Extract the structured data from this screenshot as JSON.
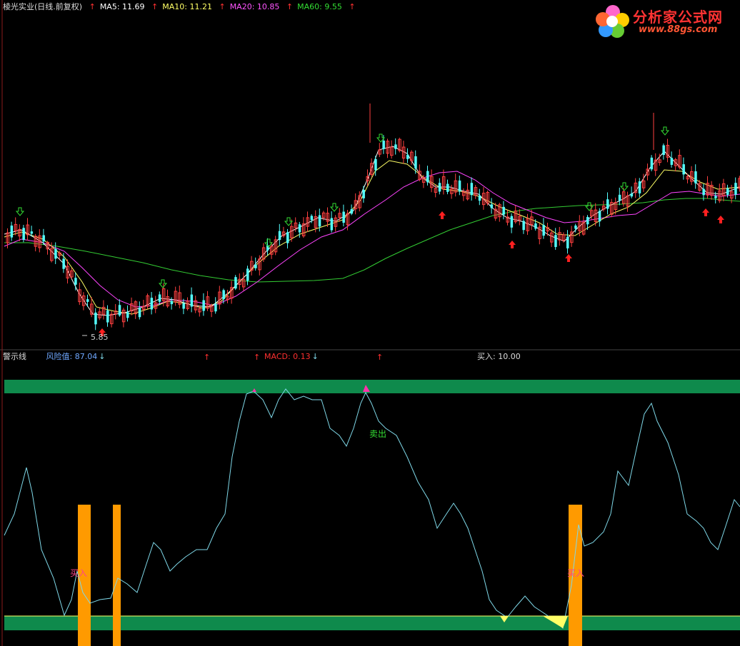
{
  "top": {
    "title": "棱光实业(日线.前复权)",
    "ma5": "MA5: 11.69",
    "ma10": "MA10: 11.21",
    "ma20": "MA20: 10.85",
    "ma60": "MA60: 9.55",
    "low_label": "5.85"
  },
  "bottom": {
    "title": "警示线",
    "risk": "风险值: 87.04",
    "macd": "MACD: 0.13",
    "buy_value": "买入: 10.00",
    "sell_label": "卖出",
    "buy_label1": "买入",
    "buy_label2": "买入"
  },
  "logo": {
    "text": "分析家公式网",
    "url": "www.88gs.com"
  },
  "colors": {
    "ma5": "#ffffff",
    "ma10": "#ffff66",
    "ma20": "#ff44ff",
    "ma60": "#33cc33",
    "up": "#ff4040",
    "down": "#54ffff",
    "band": "#0f8a4c",
    "bar": "#ff9a00",
    "risk": "#7fd8e8"
  },
  "chart_data": [
    {
      "type": "line",
      "title": "棱光实业(日线.前复权)",
      "series": [
        {
          "name": "MA5",
          "last": 11.69
        },
        {
          "name": "MA10",
          "last": 11.21
        },
        {
          "name": "MA20",
          "last": 10.85
        },
        {
          "name": "MA60",
          "last": 9.55
        }
      ],
      "min_price": 5.85
    },
    {
      "type": "line",
      "title": "警示线",
      "series": [
        {
          "name": "风险值",
          "last": 87.04
        },
        {
          "name": "MACD",
          "last": 0.13
        }
      ],
      "buy": 10.0
    }
  ]
}
